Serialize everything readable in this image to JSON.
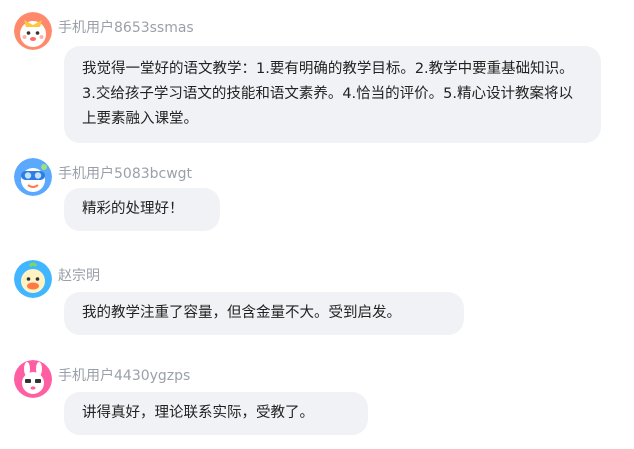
{
  "comments": [
    {
      "user": "手机用户8653ssmas",
      "avatar_icon": "fox-avatar-icon",
      "text": "我觉得一堂好的语文教学：1.要有明确的教学目标。2.教学中要重基础知识。3.交给孩子学习语文的技能和语文素养。4.恰当的评价。5.精心设计教案将以上要素融入课堂。"
    },
    {
      "user": "手机用户5083bcwgt",
      "avatar_icon": "diver-goggles-avatar-icon",
      "text": "精彩的处理好！"
    },
    {
      "user": "赵宗明",
      "avatar_icon": "duck-avatar-icon",
      "text": "我的教学注重了容量，但含金量不大。受到启发。"
    },
    {
      "user": "手机用户4430ygzps",
      "avatar_icon": "bunny-avatar-icon",
      "text": "讲得真好，理论联系实际，受教了。"
    }
  ],
  "colors": {
    "bubble_bg": "#f1f2f6",
    "username": "#9aa0aa",
    "text": "#222222"
  }
}
